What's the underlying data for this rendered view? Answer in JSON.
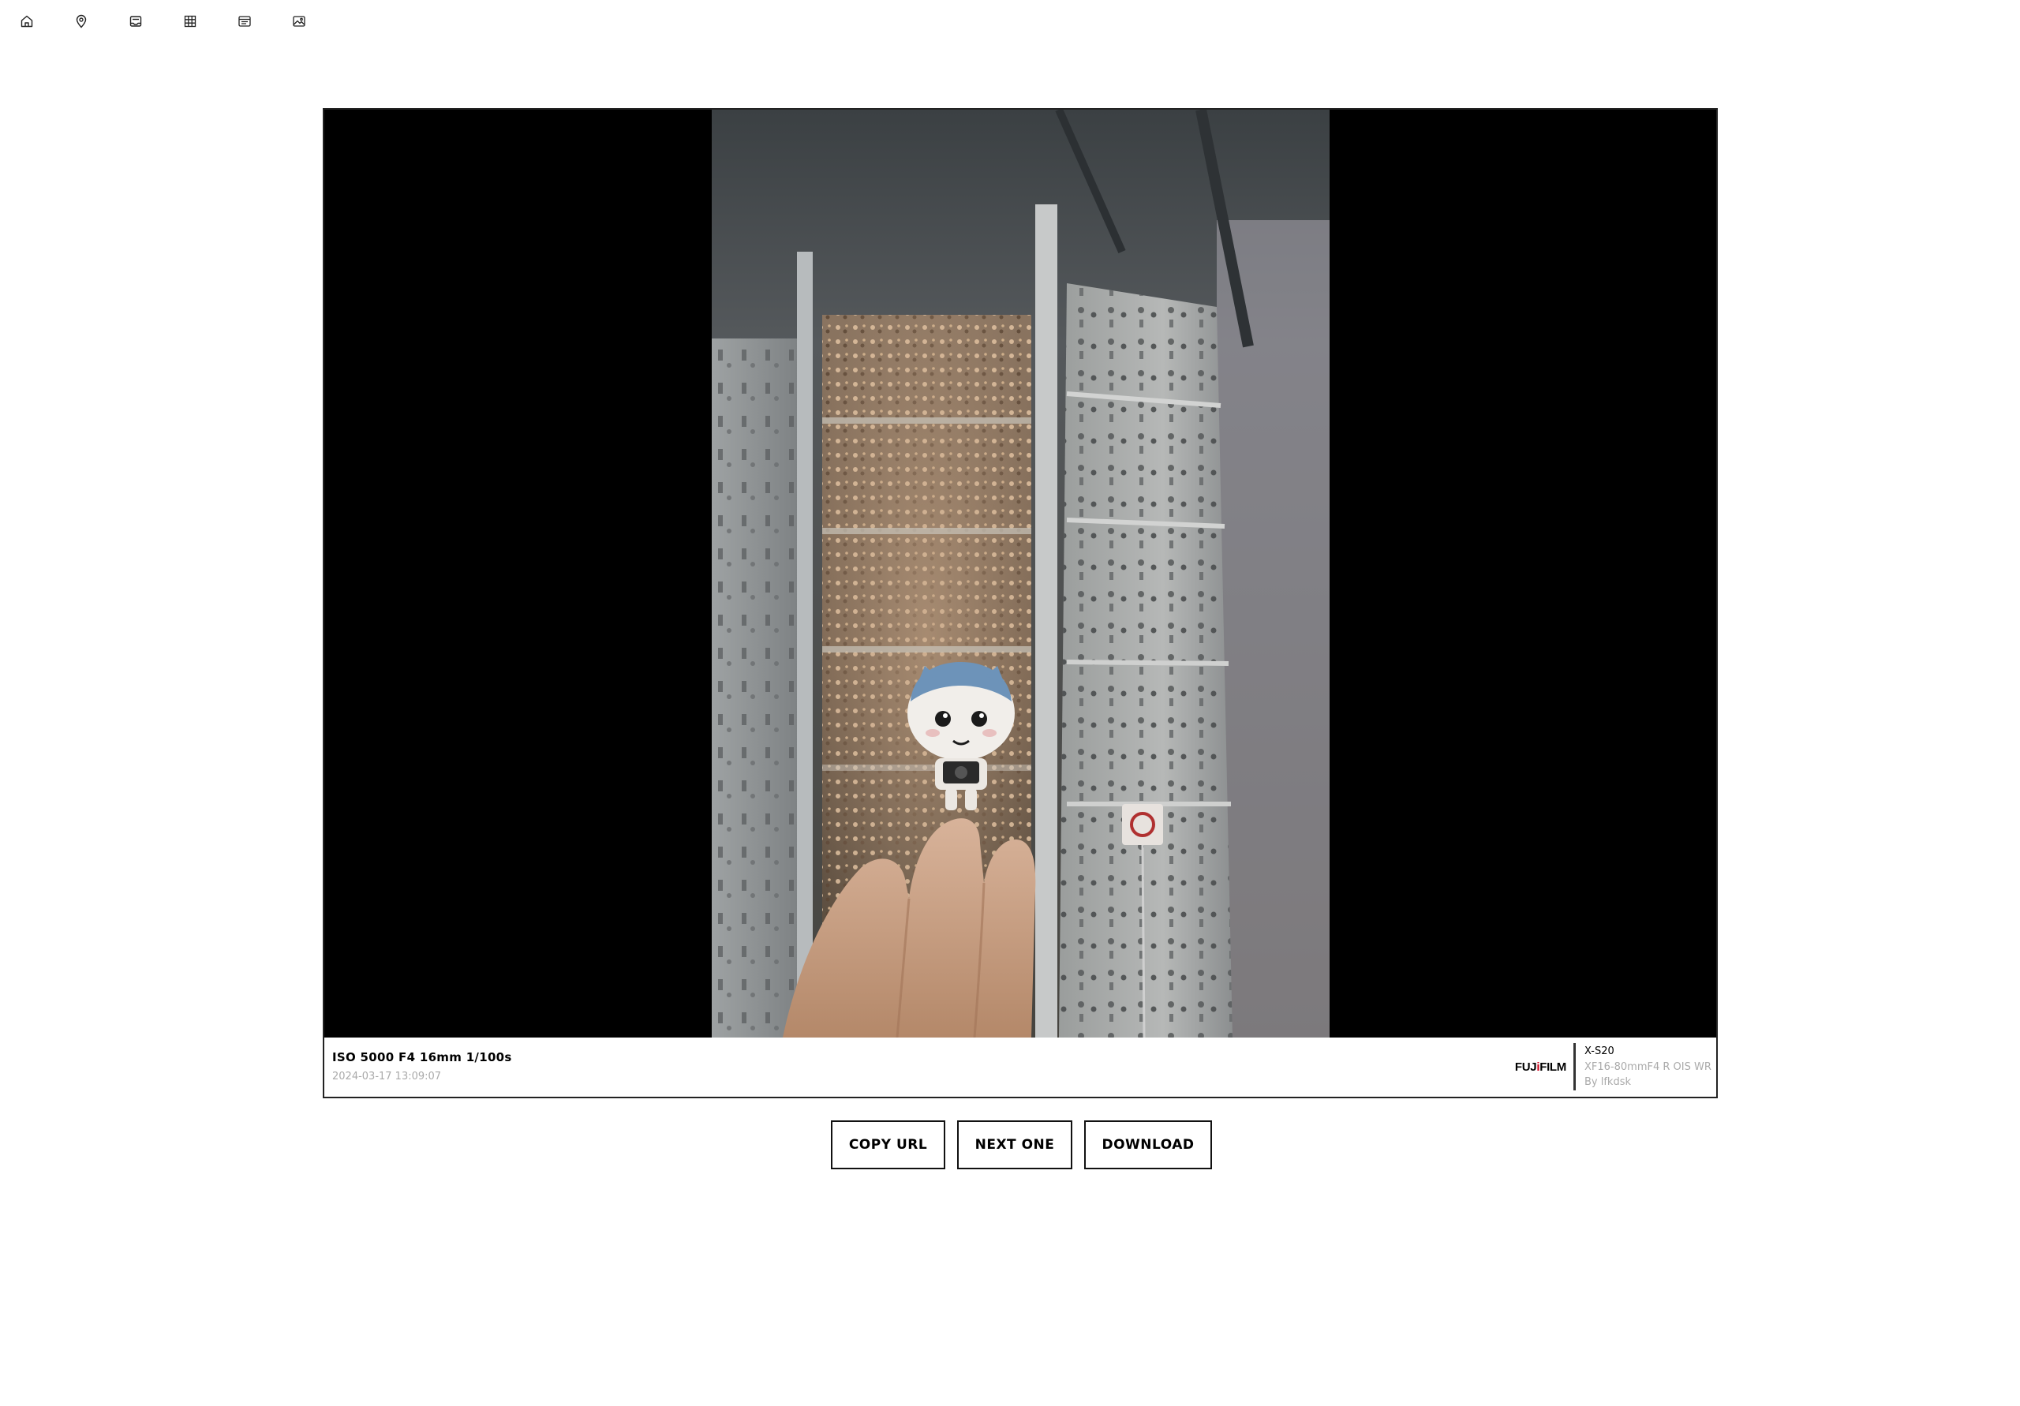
{
  "nav": {
    "items": [
      {
        "name": "home-icon"
      },
      {
        "name": "map-pin-icon"
      },
      {
        "name": "photo-album-icon"
      },
      {
        "name": "grid-icon"
      },
      {
        "name": "list-icon"
      },
      {
        "name": "image-icon"
      }
    ]
  },
  "photo": {
    "exif": "ISO 5000 F4 16mm 1/100s",
    "datetime": "2024-03-17 13:09:07",
    "brand": {
      "prefix": "FUJ",
      "mark": "i",
      "suffix": "FILM"
    },
    "camera_model": "X-S20",
    "lens": "XF16-80mmF4 R OIS WR",
    "author": "By lfkdsk"
  },
  "actions": {
    "copy_url": "COPY URL",
    "next_one": "NEXT ONE",
    "download": "DOWNLOAD"
  },
  "colors": {
    "background": "#ffffff",
    "border": "#111111",
    "brand_accent": "#d0021b",
    "muted_text": "#aaaaaa"
  }
}
